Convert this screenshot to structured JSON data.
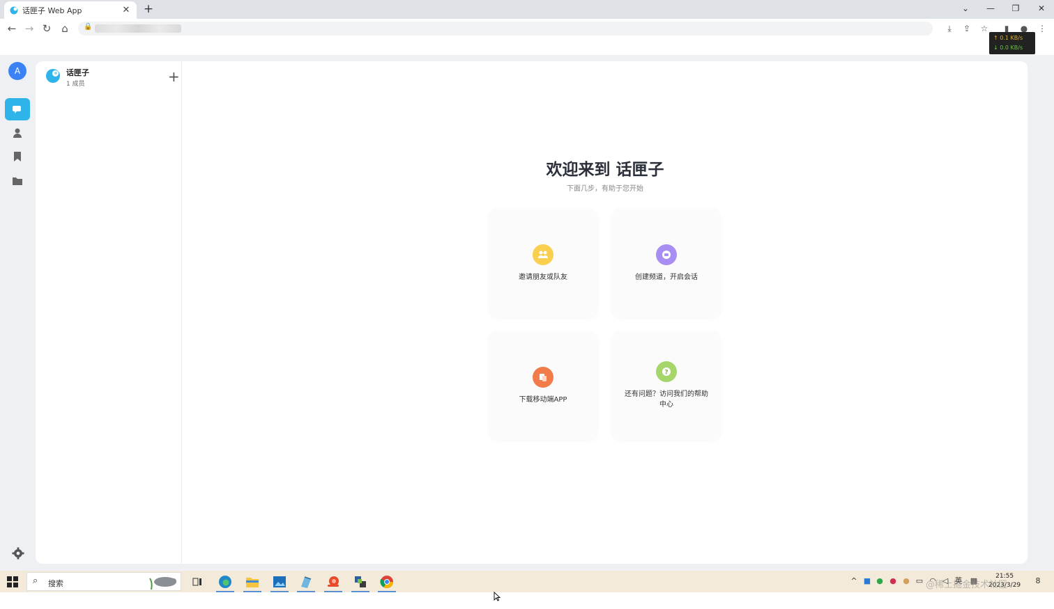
{
  "browser": {
    "tab_title": "话匣子 Web App",
    "tab_close": "✕",
    "new_tab": "+",
    "netspeed_up": "↑ 0.1 KB/s",
    "netspeed_down": "↓ 0.0 KB/s"
  },
  "space": {
    "name": "话匣子",
    "members": "1 成员",
    "avatar_letter": "A"
  },
  "welcome": {
    "title": "欢迎来到 话匣子",
    "subtitle": "下面几步，有助于您开始",
    "cards": [
      {
        "label": "邀请朋友或队友",
        "color": "#f8cf4f"
      },
      {
        "label": "创建频道，开启会话",
        "color": "#a88ef2"
      },
      {
        "label": "下载移动端APP",
        "color": "#f27b4a"
      },
      {
        "label": "还有问题？访问我们的帮助中心",
        "color": "#a6d66a"
      }
    ]
  },
  "colors": {
    "accent": "#2fb4e9",
    "avatar": "#3b82f6"
  },
  "taskbar": {
    "search_placeholder": "搜索",
    "ime": "英",
    "time": "21:55",
    "date": "2023/3/29",
    "notifications": "8"
  },
  "watermark": "@稀土掘金技术社区"
}
